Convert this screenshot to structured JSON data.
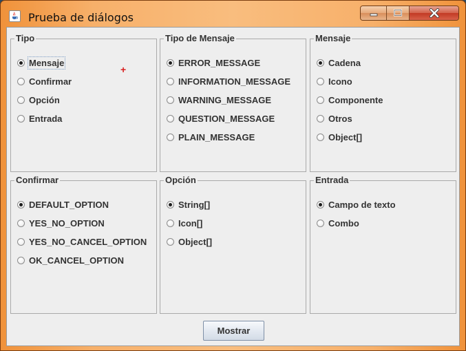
{
  "window": {
    "title": "Prueba de diálogos",
    "icon": "java-coffee-cup-icon",
    "caption_buttons": [
      "minimize-icon",
      "maximize-icon",
      "close-icon"
    ]
  },
  "groups": {
    "tipo": {
      "title": "Tipo",
      "options": [
        "Mensaje",
        "Confirmar",
        "Opción",
        "Entrada"
      ],
      "selected": "Mensaje"
    },
    "tipo_mensaje": {
      "title": "Tipo de Mensaje",
      "options": [
        "ERROR_MESSAGE",
        "INFORMATION_MESSAGE",
        "WARNING_MESSAGE",
        "QUESTION_MESSAGE",
        "PLAIN_MESSAGE"
      ],
      "selected": "ERROR_MESSAGE"
    },
    "mensaje": {
      "title": "Mensaje",
      "options": [
        "Cadena",
        "Icono",
        "Componente",
        "Otros",
        "Object[]"
      ],
      "selected": "Cadena"
    },
    "confirmar": {
      "title": "Confirmar",
      "options": [
        "DEFAULT_OPTION",
        "YES_NO_OPTION",
        "YES_NO_CANCEL_OPTION",
        "OK_CANCEL_OPTION"
      ],
      "selected": "DEFAULT_OPTION"
    },
    "opcion": {
      "title": "Opción",
      "options": [
        "String[]",
        "Icon[]",
        "Object[]"
      ],
      "selected": "String[]"
    },
    "entrada": {
      "title": "Entrada",
      "options": [
        "Campo de texto",
        "Combo"
      ],
      "selected": "Campo de texto"
    }
  },
  "mostrar_button": {
    "label": "Mostrar"
  },
  "colors": {
    "titlebar": "#f7b06a",
    "client_background": "#eeeeee",
    "cursor_mark": "#d81e1e"
  }
}
